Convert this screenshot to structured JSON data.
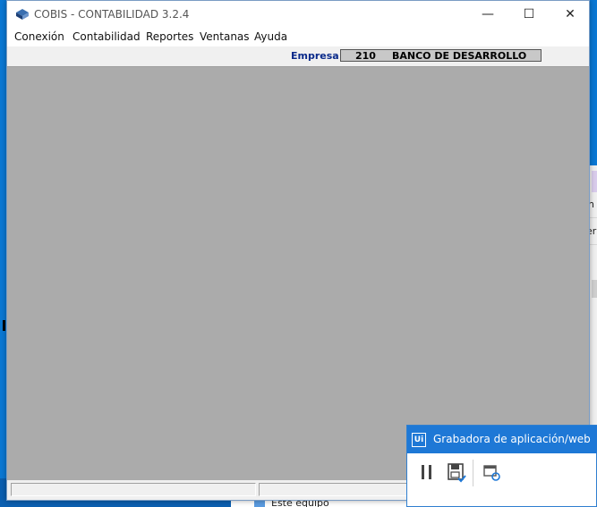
{
  "app": {
    "title": "COBIS - CONTABILIDAD 3.2.4",
    "window_controls": {
      "minimize": "—",
      "maximize": "☐",
      "close": "✕"
    }
  },
  "menu": [
    "Conexión",
    "Contabilidad",
    "Reportes",
    "Ventanas",
    "Ayuda"
  ],
  "company": {
    "label": "Empresa:",
    "code": "210",
    "name": "BANCO DE DESARROLLO"
  },
  "recorder": {
    "title": "Grabadora de aplicación/web",
    "logo": "Ui"
  },
  "background": {
    "explorer_item": "Este equipo",
    "fragment_1": "n",
    "fragment_2": "er"
  },
  "colors": {
    "desktop": "#0a78d4",
    "workspace": "#ababab",
    "recorder_accent": "#1e78d6",
    "company_label": "#0a2a8a"
  }
}
